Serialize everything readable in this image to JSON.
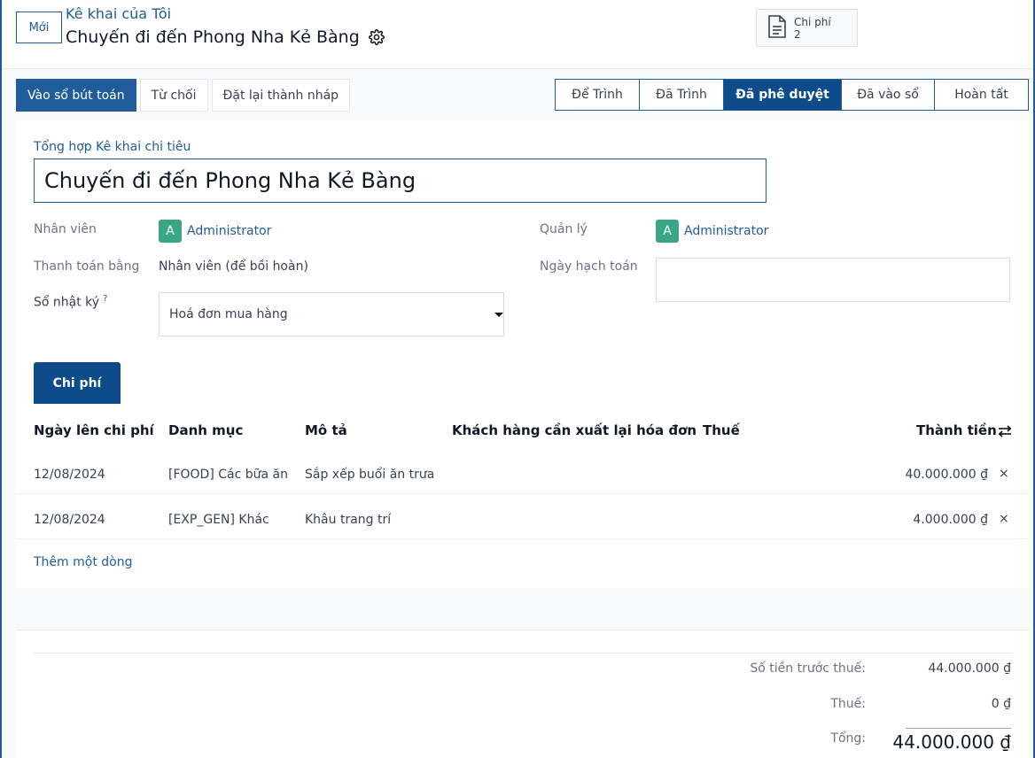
{
  "header": {
    "new_label": "Mới",
    "breadcrumb_parent": "Kê khai của Tôi",
    "breadcrumb_current": "Chuyến đi đến Phong Nha Kẻ Bàng",
    "smart_button": {
      "label": "Chi phí",
      "count": "2",
      "icon": "document-icon"
    }
  },
  "actions": {
    "post": "Vào sổ bút toán",
    "refuse": "Từ chối",
    "reset": "Đặt lại thành nháp"
  },
  "statusbar": {
    "steps": [
      "Để Trình",
      "Đã Trình",
      "Đã phê duyệt",
      "Đã vào sổ",
      "Hoàn tất"
    ],
    "active": "Đã phê duyệt"
  },
  "form": {
    "summary_label": "Tổng hợp Kê khai chi tiêu",
    "summary_value": "Chuyến đi đến Phong Nha Kẻ Bàng",
    "employee_label": "Nhân viên",
    "employee_value": "Administrator",
    "employee_initial": "A",
    "manager_label": "Quản lý",
    "manager_value": "Administrator",
    "manager_initial": "A",
    "paid_by_label": "Thanh toán bằng",
    "paid_by_value": "Nhân viên (để bồi hoàn)",
    "accounting_date_label": "Ngày hạch toán",
    "journal_label": "Sổ nhật ký",
    "journal_tooltip": "?",
    "journal_value": "Hoá đơn mua hàng"
  },
  "tab": {
    "label": "Chi phí"
  },
  "table": {
    "columns": [
      "Ngày lên chi phí",
      "Danh mục",
      "Mô tả",
      "Khách hàng cần xuất lại hóa đơn",
      "Thuế",
      "Thành tiền"
    ],
    "rows": [
      {
        "date": "12/08/2024",
        "category": "[FOOD] Các bữa ăn",
        "description": "Sắp xếp buổi ăn trưa",
        "customer": "",
        "tax": "",
        "total": "40.000.000 ₫"
      },
      {
        "date": "12/08/2024",
        "category": "[EXP_GEN] Khác",
        "description": "Khâu trang trí",
        "customer": "",
        "tax": "",
        "total": "4.000.000 ₫"
      }
    ],
    "add_line": "Thêm một dòng",
    "delete_symbol": "×"
  },
  "totals": {
    "untaxed_label": "Số tiền trước thuế:",
    "untaxed_value": "44.000.000 ₫",
    "tax_label": "Thuế:",
    "tax_value": "0 ₫",
    "total_label": "Tổng:",
    "total_value": "44.000.000 ₫"
  },
  "colors": {
    "primary": "#1f5c99",
    "active_status": "#0d4b8a",
    "avatar": "#3aa687"
  }
}
